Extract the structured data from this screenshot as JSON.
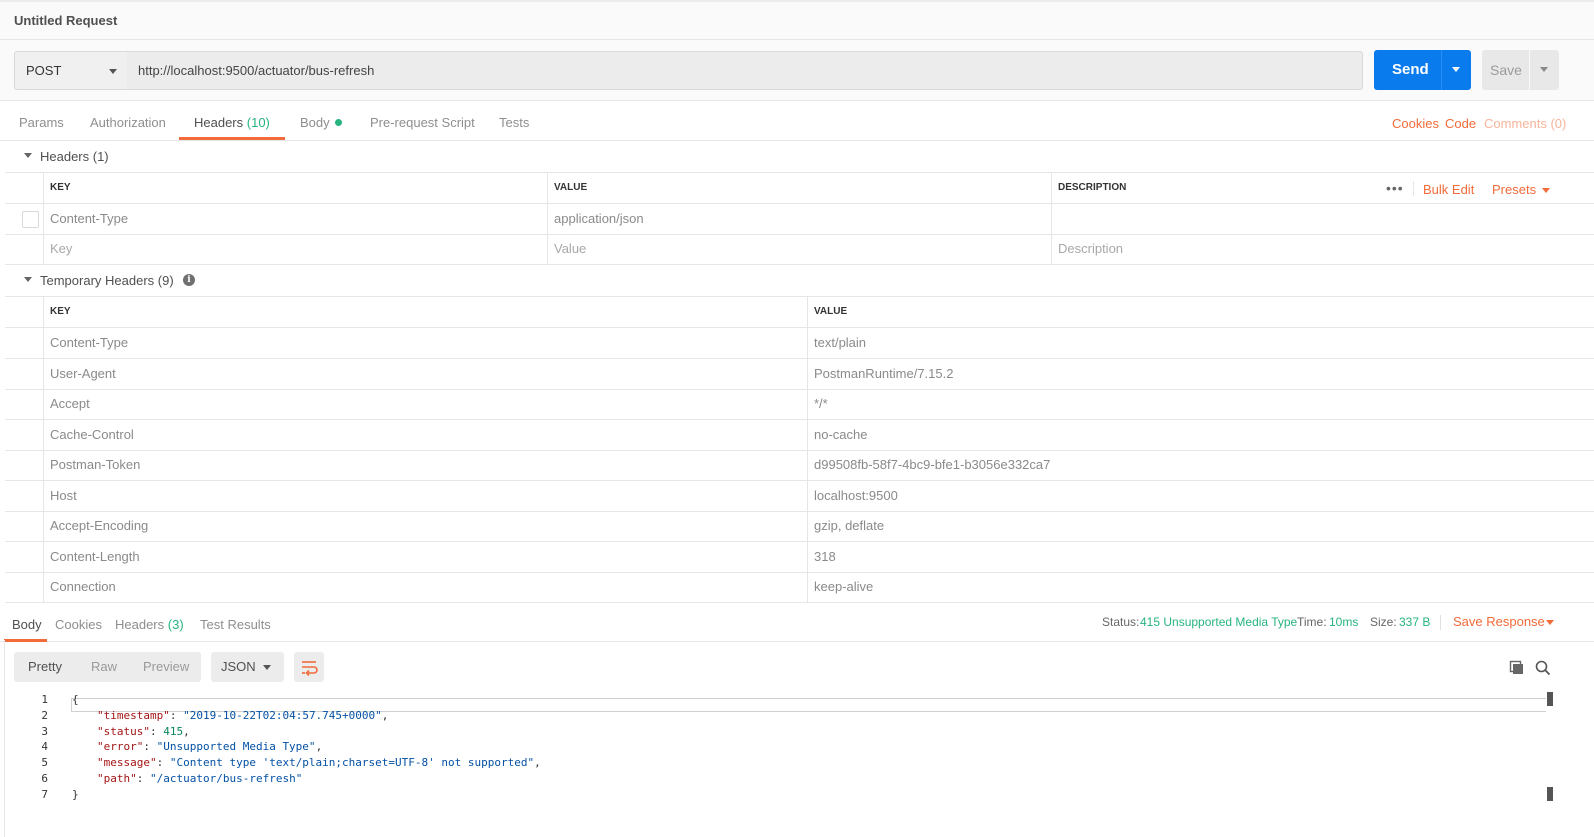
{
  "window": {
    "title": "Untitled Request"
  },
  "request": {
    "method": "POST",
    "url": "http://localhost:9500/actuator/bus-refresh",
    "send_label": "Send",
    "save_label": "Save"
  },
  "req_tabs": {
    "params": "Params",
    "authorization": "Authorization",
    "headers": "Headers",
    "headers_count": "(10)",
    "body": "Body",
    "prerequest": "Pre-request Script",
    "tests": "Tests",
    "cookies": "Cookies",
    "code": "Code",
    "comments": "Comments (0)"
  },
  "headers_section": {
    "title": "Headers (1)",
    "col_key": "KEY",
    "col_value": "VALUE",
    "col_description": "DESCRIPTION",
    "more_icon": "•••",
    "bulk_edit": "Bulk Edit",
    "presets": "Presets",
    "rows": [
      {
        "key": "Content-Type",
        "value": "application/json",
        "description": ""
      }
    ],
    "placeholder": {
      "key": "Key",
      "value": "Value",
      "description": "Description"
    }
  },
  "temp_headers": {
    "title": "Temporary Headers (9)",
    "info_icon": "i",
    "col_key": "KEY",
    "col_value": "VALUE",
    "rows": [
      {
        "key": "Content-Type",
        "value": "text/plain"
      },
      {
        "key": "User-Agent",
        "value": "PostmanRuntime/7.15.2"
      },
      {
        "key": "Accept",
        "value": "*/*"
      },
      {
        "key": "Cache-Control",
        "value": "no-cache"
      },
      {
        "key": "Postman-Token",
        "value": "d99508fb-58f7-4bc9-bfe1-b3056e332ca7"
      },
      {
        "key": "Host",
        "value": "localhost:9500"
      },
      {
        "key": "Accept-Encoding",
        "value": "gzip, deflate"
      },
      {
        "key": "Content-Length",
        "value": "318"
      },
      {
        "key": "Connection",
        "value": "keep-alive"
      }
    ]
  },
  "response": {
    "tabs": {
      "body": "Body",
      "cookies": "Cookies",
      "headers": "Headers",
      "headers_count": "(3)",
      "test_results": "Test Results"
    },
    "status_label": "Status:",
    "status_value": "415 Unsupported Media Type",
    "time_label": "Time:",
    "time_value": "10ms",
    "size_label": "Size:",
    "size_value": "337 B",
    "save_response": "Save Response",
    "format": {
      "pretty": "Pretty",
      "raw": "Raw",
      "preview": "Preview",
      "lang": "JSON"
    },
    "icons": {
      "wrap": "wrap-lines-icon",
      "copy": "copy-icon",
      "search": "search-icon"
    },
    "body_lines": [
      {
        "n": "1",
        "text": "{"
      },
      {
        "n": "2",
        "key": "\"timestamp\"",
        "sep": ": ",
        "val": "\"2019-10-22T02:04:57.745+0000\"",
        "end": ",",
        "type": "s"
      },
      {
        "n": "3",
        "key": "\"status\"",
        "sep": ": ",
        "val": "415",
        "end": ",",
        "type": "n"
      },
      {
        "n": "4",
        "key": "\"error\"",
        "sep": ": ",
        "val": "\"Unsupported Media Type\"",
        "end": ",",
        "type": "s"
      },
      {
        "n": "5",
        "key": "\"message\"",
        "sep": ": ",
        "val": "\"Content type 'text/plain;charset=UTF-8' not supported\"",
        "end": ",",
        "type": "s"
      },
      {
        "n": "6",
        "key": "\"path\"",
        "sep": ": ",
        "val": "\"/actuator/bus-refresh\"",
        "end": "",
        "type": "s"
      },
      {
        "n": "7",
        "text": "}"
      }
    ]
  },
  "colors": {
    "accent": "#f26b3a",
    "send": "#097bed",
    "success": "#26b47f"
  }
}
